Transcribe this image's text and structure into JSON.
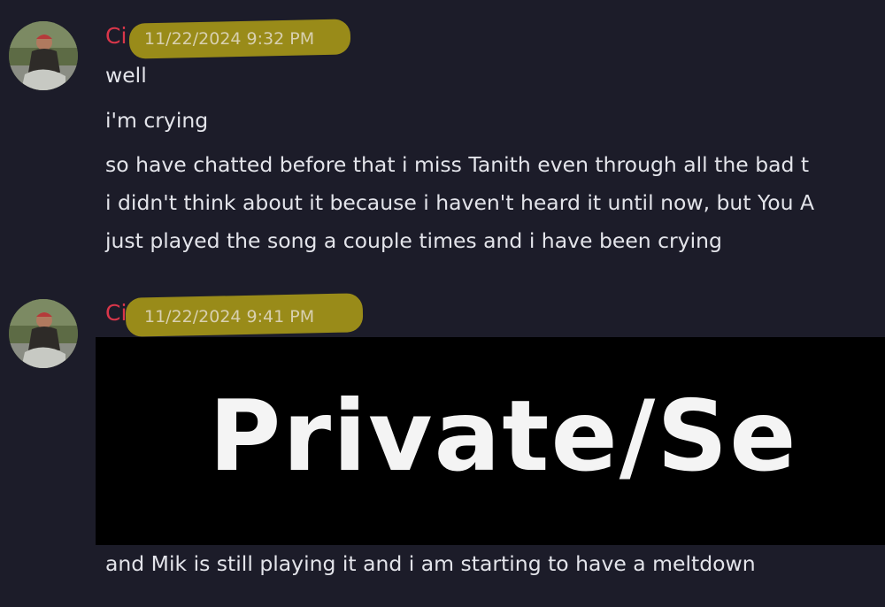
{
  "messages": [
    {
      "username": "Ci",
      "timestamp": "11/22/2024 9:32 PM",
      "lines": [
        "well",
        "i'm crying",
        "so have chatted before that i miss Tanith even through all the bad t",
        "i didn't think about it because i haven't heard it until now, but You A",
        "just played the song a couple times and i have been crying"
      ]
    },
    {
      "username": "Ci",
      "timestamp": "11/22/2024 9:41 PM",
      "embed_text": "Private/Se",
      "lines": [
        "and Mik is still playing it and i am starting to have a meltdown"
      ]
    }
  ],
  "colors": {
    "background": "#1c1c29",
    "username": "#d9364a",
    "highlight": "#bcaa14",
    "text": "#e3e4ea",
    "embed_background": "#000000"
  }
}
